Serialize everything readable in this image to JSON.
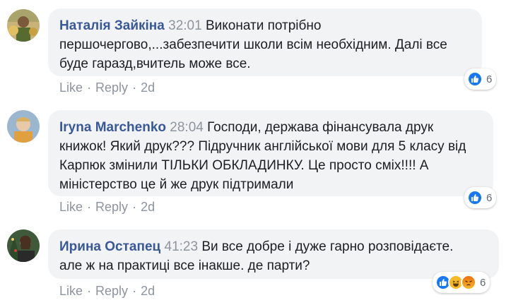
{
  "comments": [
    {
      "author": "Наталія Зайкіна",
      "timestamp": "32:01",
      "lines": [
        "Виконати потрібно",
        "першочергово,...забезпечити школи всім необхідним. Далі все",
        "буде гаразд,вчитель може все."
      ],
      "actions": {
        "like": "Like",
        "reply": "Reply",
        "age": "2d"
      },
      "reactions": {
        "icons": [
          "like-icon"
        ],
        "count": "6"
      }
    },
    {
      "author": "Iryna Marchenko",
      "timestamp": "28:04",
      "lines": [
        "Господи, держава фінансувала друк",
        "книжок! Який друк??? Підручник англійської мови для 5 класу від",
        "Карпюк змінили ТІЛЬКИ ОБКЛАДИНКУ. Це просто сміх!!!! А",
        "міністерство це й же друк підтримали"
      ],
      "actions": {
        "like": "Like",
        "reply": "Reply",
        "age": "2d"
      },
      "reactions": {
        "icons": [
          "like-icon"
        ],
        "count": "6"
      }
    },
    {
      "author": "Ирина Остапец",
      "timestamp": "41:23",
      "lines": [
        "Ви все добре і дуже гарно розповідаєте.",
        "але ж на практиці все інакше. де парти?"
      ],
      "actions": {
        "like": "Like",
        "reply": "Reply",
        "age": "2d"
      },
      "reactions": {
        "icons": [
          "like-icon",
          "haha-icon",
          "angry-icon"
        ],
        "count": "6"
      }
    }
  ],
  "colors": {
    "author": "#385898",
    "timestamp": "#8d949e",
    "bubble": "#f2f3f5",
    "like": "#1877f2"
  }
}
